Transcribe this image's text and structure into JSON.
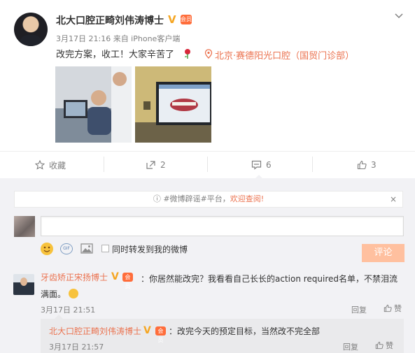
{
  "post": {
    "author": "北大口腔正畸刘伟涛博士",
    "member_badge": "会员",
    "meta": "3月17日 21:16 来自 iPhone客户端",
    "text": "改完方案，收工！大家辛苦了",
    "location": "北京·赛德阳光口腔（国贸门诊部）",
    "photos": [
      "photo-doctor-at-computer",
      "photo-dental-software-monitor"
    ]
  },
  "actions": {
    "favorite": "收藏",
    "repost_count": "2",
    "comment_count": "6",
    "like_count": "3"
  },
  "notice": {
    "prefix": "#微博辟谣#平台，",
    "link": "欢迎查阅!",
    "close": "×"
  },
  "composer": {
    "repost_label": "同时转发到我的微博",
    "submit_label": "评论"
  },
  "comment1": {
    "author": "牙齿矫正宋扬博士",
    "text": "：你居然能改完？我看看自己长长的action required名单，不禁泪流满面。",
    "time": "3月17日 21:51",
    "reply": "回复",
    "like": "赞"
  },
  "subcomment": {
    "author": "北大口腔正畸刘伟涛博士",
    "text": "：改完今天的预定目标，当然改不完全部",
    "time": "3月17日 21:57",
    "reply": "回复",
    "like": "赞"
  },
  "colors": {
    "accent": "#eb7350",
    "verified": "#f5a623",
    "submit_disabled": "#ffc09f"
  }
}
